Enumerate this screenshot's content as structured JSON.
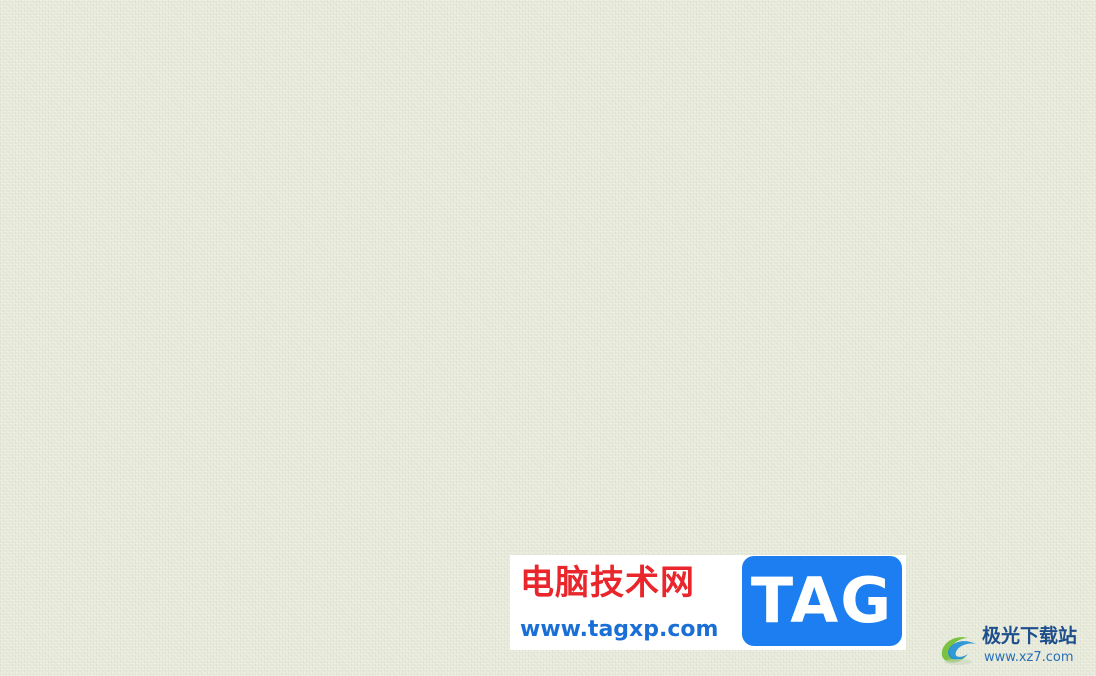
{
  "background": {
    "color": "#e9ecdc"
  },
  "watermark": {
    "site_name": "电脑技术网",
    "site_url": "www.tagxp.com",
    "tag_label": "TAG",
    "title_color": "#e8262b",
    "url_color": "#1a6fd6",
    "tag_color": "#1c7ef0"
  },
  "corner_logo": {
    "name": "极光下载站",
    "url": "www.xz7.com",
    "icon": "swirl-logo-icon",
    "text_color": "#1f4e8c"
  }
}
